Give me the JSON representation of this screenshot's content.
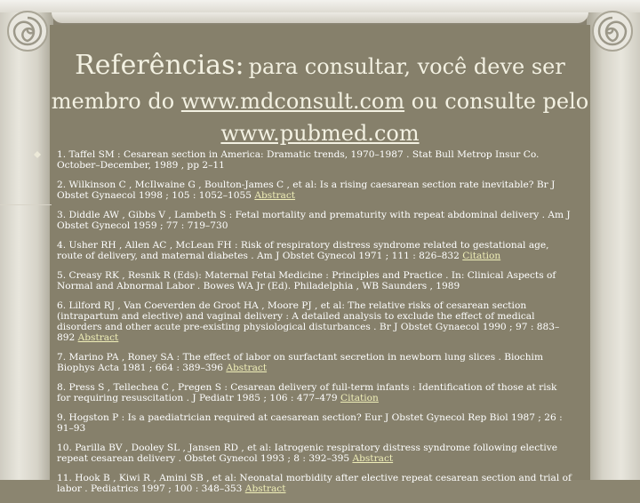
{
  "title": {
    "line1_big": "Referências:",
    "line1_rest": "para consultar, você deve ser",
    "line2_pre": "membro do",
    "link1": "www.mdconsult.com",
    "line2_post": "ou consulte pelo",
    "link2": "www.pubmed.com"
  },
  "references": [
    {
      "text": "1. Taffel SM : Cesarean section in America: Dramatic trends, 1970–1987 . Stat Bull Metrop Insur Co. October–December, 1989 , pp 2–11",
      "link": ""
    },
    {
      "text": "2. Wilkinson C , McIlwaine G , Boulton-James C , et al: Is a rising caesarean section rate inevitable? Br J Obstet Gynaecol 1998 ; 105 : 1052–1055",
      "link": "Abstract"
    },
    {
      "text": "3. Diddle AW , Gibbs V , Lambeth S : Fetal mortality and prematurity with repeat abdominal delivery . Am J Obstet Gynecol 1959 ; 77 : 719–730",
      "link": ""
    },
    {
      "text": "4. Usher RH , Allen AC , McLean FH : Risk of respiratory distress syndrome related to gestational age, route of delivery, and maternal diabetes . Am J Obstet Gynecol 1971 ; 111 : 826–832",
      "link": "Citation"
    },
    {
      "text": "5. Creasy RK , Resnik R (Eds): Maternal Fetal Medicine : Principles and Practice . In: Clinical Aspects of Normal and Abnormal Labor . Bowes WA Jr (Ed). Philadelphia , WB Saunders , 1989",
      "link": ""
    },
    {
      "text": "6. Lilford RJ , Van Coeverden de Groot HA , Moore PJ , et al: The relative risks of cesarean section (intrapartum and elective) and vaginal delivery : A detailed analysis to exclude the effect of medical disorders and other acute pre-existing physiological disturbances . Br J Obstet Gynaecol 1990 ; 97 : 883–892",
      "link": "Abstract"
    },
    {
      "text": "7. Marino PA , Roney SA : The effect of labor on surfactant secretion in newborn lung slices . Biochim Biophys Acta 1981 ; 664 : 389–396",
      "link": "Abstract"
    },
    {
      "text": "8. Press S , Tellechea C , Pregen S : Cesarean delivery of full-term infants : Identification of those at risk for requiring resuscitation . J Pediatr 1985 ; 106 : 477–479",
      "link": "Citation"
    },
    {
      "text": "9. Hogston P : Is a paediatrician required at caesarean section? Eur J Obstet Gynecol Rep Biol 1987 ; 26 : 91–93",
      "link": ""
    },
    {
      "text": "10. Parilla BV , Dooley SL , Jansen RD , et al: Iatrogenic respiratory distress syndrome following elective repeat cesarean delivery . Obstet Gynecol 1993 ; 8 : 392–395",
      "link": "Abstract"
    },
    {
      "text": "11. Hook B , Kiwi R , Amini SB , et al: Neonatal morbidity after elective repeat cesarean section and trial of labor . Pediatrics 1997 ; 100 : 348–353",
      "link": "Abstract"
    }
  ]
}
